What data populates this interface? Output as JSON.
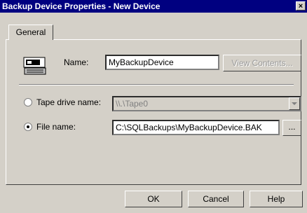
{
  "window": {
    "title": "Backup Device Properties - New Device",
    "close_glyph": "×"
  },
  "tabs": [
    {
      "label": "General"
    }
  ],
  "name_row": {
    "label": "Name:",
    "value": "MyBackupDevice",
    "view_contents_label": "View Contents..."
  },
  "tape": {
    "label": "Tape drive name:",
    "value": "\\\\.\\Tape0",
    "selected": false
  },
  "file": {
    "label": "File name:",
    "value": "C:\\SQLBackups\\MyBackupDevice.BAK",
    "browse_label": "...",
    "selected": true
  },
  "buttons": {
    "ok": "OK",
    "cancel": "Cancel",
    "help": "Help"
  }
}
